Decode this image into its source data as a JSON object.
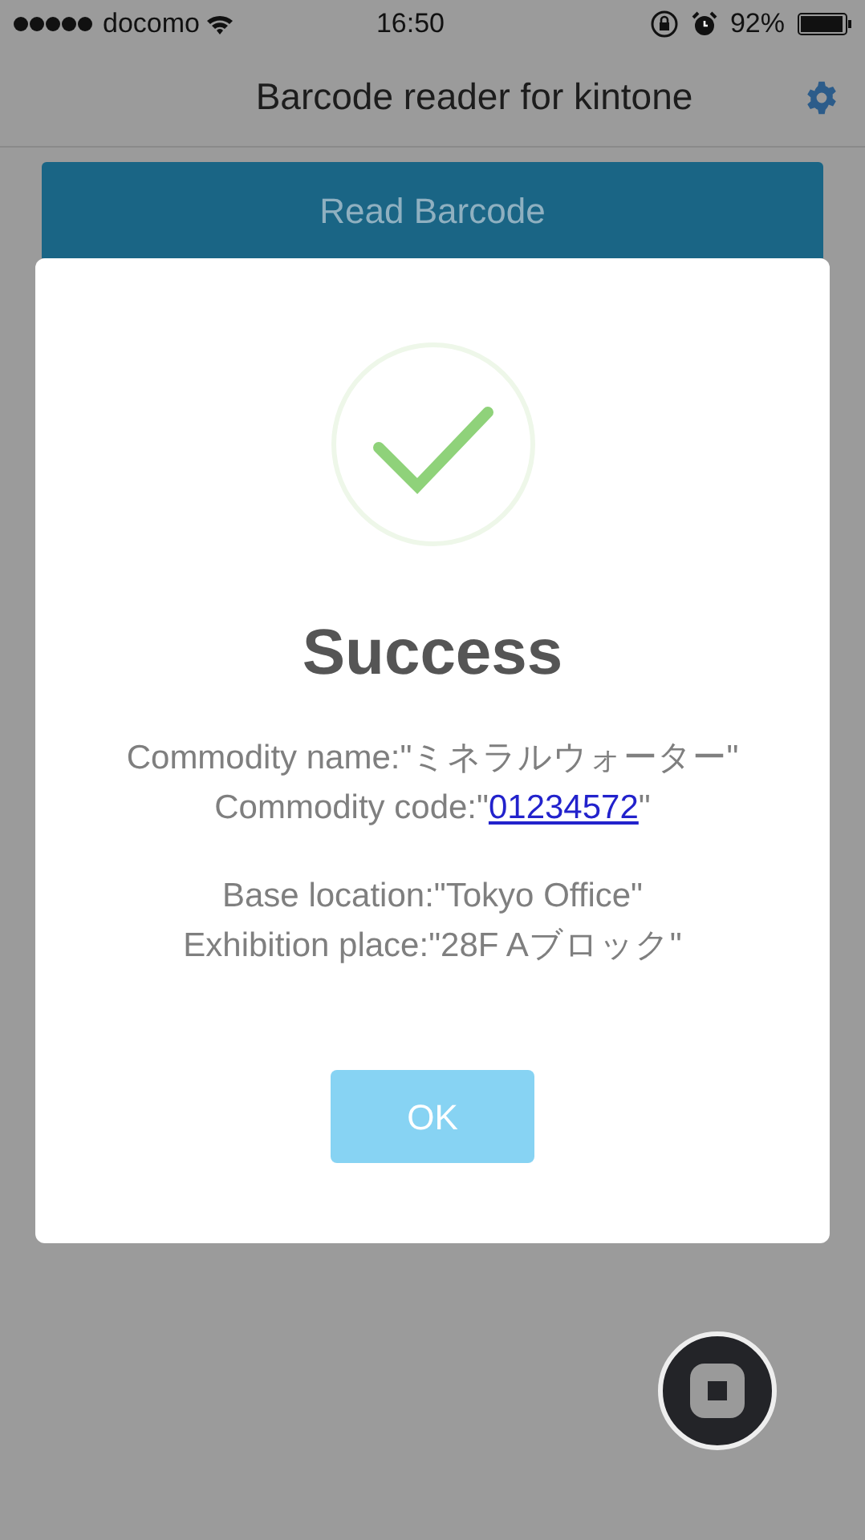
{
  "status_bar": {
    "carrier": "docomo",
    "time": "16:50",
    "battery": "92%"
  },
  "navbar": {
    "title": "Barcode reader for kintone"
  },
  "read_button": {
    "label": "Read Barcode"
  },
  "dialog": {
    "title": "Success",
    "groups": [
      {
        "lines": [
          {
            "kind": "text",
            "text": "Commodity name:\"ミネラルウォーター\""
          },
          {
            "kind": "link",
            "prefix": "Commodity code:\"",
            "link": "01234572",
            "suffix": "\""
          }
        ]
      },
      {
        "lines": [
          {
            "kind": "text",
            "text": "Base location:\"Tokyo Office\""
          },
          {
            "kind": "text",
            "text": "Exhibition place:\"28F Aブロック\""
          }
        ]
      }
    ],
    "ok_button": "OK"
  }
}
